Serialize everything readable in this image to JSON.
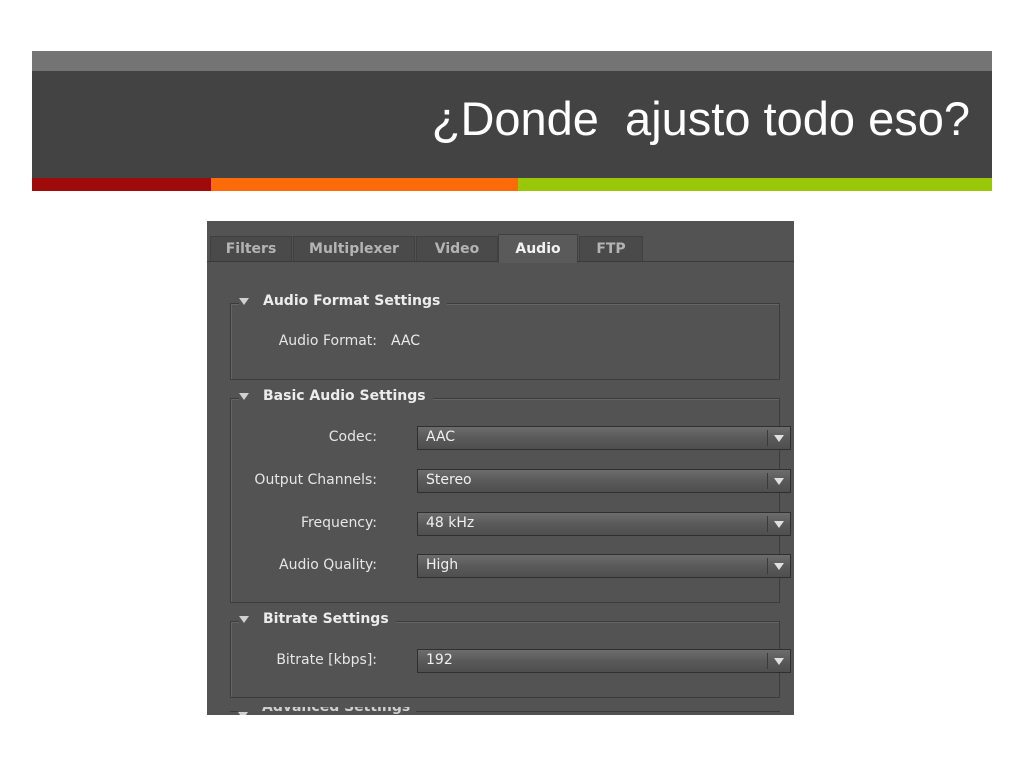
{
  "slide": {
    "title": "¿Donde  ajusto todo eso?"
  },
  "tabs": [
    {
      "label": "Filters",
      "active": false
    },
    {
      "label": "Multiplexer",
      "active": false
    },
    {
      "label": "Video",
      "active": false
    },
    {
      "label": "Audio",
      "active": true
    },
    {
      "label": "FTP",
      "active": false
    }
  ],
  "audio_format_settings": {
    "header": "Audio Format Settings",
    "format_label": "Audio Format:",
    "format_value": "AAC"
  },
  "basic_audio_settings": {
    "header": "Basic Audio Settings",
    "codec_label": "Codec:",
    "codec_value": "AAC",
    "channels_label": "Output Channels:",
    "channels_value": "Stereo",
    "frequency_label": "Frequency:",
    "frequency_value": "48 kHz",
    "quality_label": "Audio Quality:",
    "quality_value": "High"
  },
  "bitrate_settings": {
    "header": "Bitrate Settings",
    "bitrate_label": "Bitrate [kbps]:",
    "bitrate_value": "192"
  },
  "advanced_settings": {
    "header": "Advanced Settings"
  },
  "colors": {
    "header_dark": "#434343",
    "header_light": "#747474",
    "stripe_red": "#9f0a0a",
    "stripe_orange": "#fd6a0a",
    "stripe_green": "#98c808",
    "panel_bg": "#535353"
  },
  "icons": {
    "group_toggle": "triangle-down-icon",
    "dropdown": "chevron-down-icon"
  }
}
